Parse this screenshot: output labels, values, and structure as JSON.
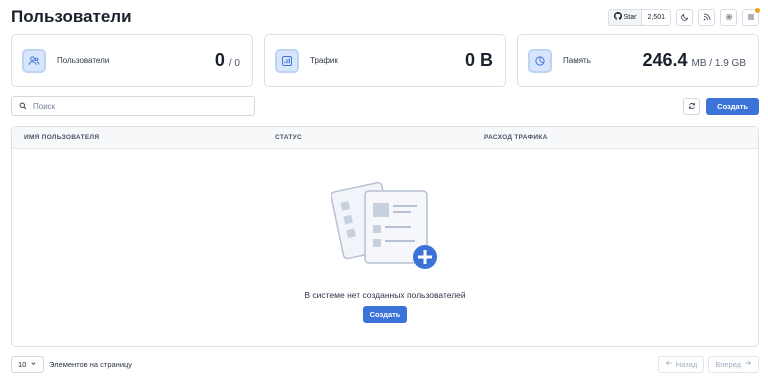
{
  "header": {
    "title": "Пользователи",
    "github": {
      "star_label": "Star",
      "star_count": "2,501"
    }
  },
  "stats": {
    "users": {
      "label": "Пользователи",
      "value": "0",
      "suffix": "/ 0"
    },
    "traffic": {
      "label": "Трафик",
      "value": "0 B"
    },
    "memory": {
      "label": "Память",
      "value": "246.4",
      "suffix": "MB / 1.9 GB"
    }
  },
  "toolbar": {
    "search_placeholder": "Поиск",
    "create_label": "Создать"
  },
  "table": {
    "columns": [
      "ИМЯ ПОЛЬЗОВАТЕЛЯ",
      "СТАТУС",
      "РАСХОД ТРАФИКА"
    ],
    "rows": [],
    "empty_text": "В системе нет созданных пользователей",
    "empty_create_label": "Создать"
  },
  "pagination": {
    "page_size": "10",
    "per_page_label": "Элементов на страницу",
    "prev_label": "Назад",
    "next_label": "Вперед"
  },
  "colors": {
    "accent": "#3b73d9",
    "notification_dot": "#f2a516"
  },
  "icons": [
    "github-icon",
    "moon-icon",
    "rss-icon",
    "gear-icon",
    "menu-icon",
    "users-icon",
    "chart-icon",
    "pie-icon",
    "search-icon",
    "refresh-icon",
    "chevron-down-icon",
    "arrow-left-icon",
    "arrow-right-icon"
  ]
}
